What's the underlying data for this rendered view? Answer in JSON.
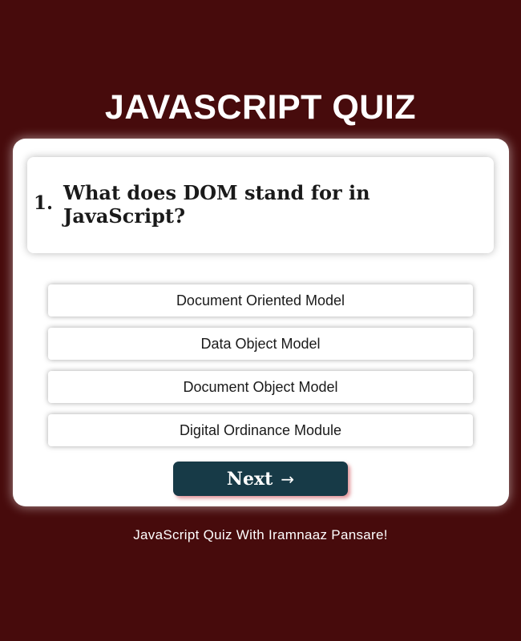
{
  "quiz": {
    "title": "JAVASCRIPT QUIZ",
    "question": {
      "number": "1.",
      "text": "What does DOM stand for in JavaScript?"
    },
    "options": [
      "Document Oriented Model",
      "Data Object Model",
      "Document Object Model",
      "Digital Ordinance Module"
    ],
    "next_button": {
      "label": "Next",
      "icon": "arrow-right-icon",
      "arrow_glyph": "→"
    },
    "footer": "JavaScript Quiz With Iramnaaz Pansare!"
  },
  "colors": {
    "background": "#470b0c",
    "card": "#ffffff",
    "button": "#173a47",
    "button_shadow": "#c83c46",
    "text_dark": "#1a1a1a",
    "text_light": "#ffffff"
  }
}
